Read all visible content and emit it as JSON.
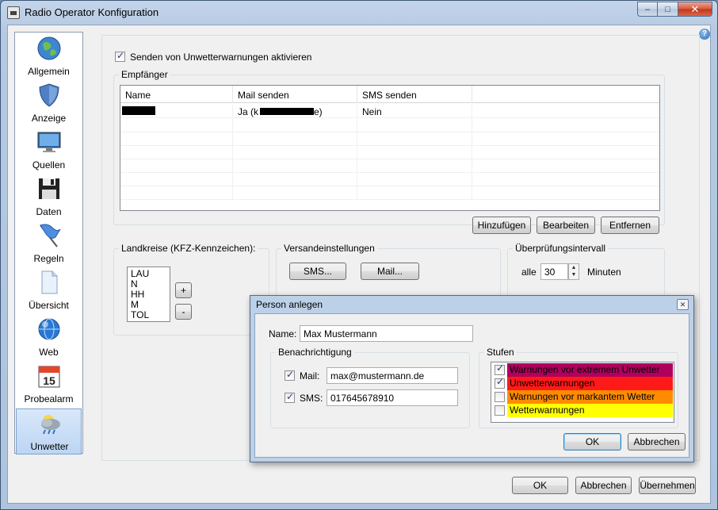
{
  "window": {
    "title": "Radio Operator Konfiguration",
    "controls": {
      "minimize": "–",
      "maximize": "□",
      "close": "✕"
    }
  },
  "sidebar": {
    "items": [
      {
        "label": "Allgemein",
        "icon": "globe-icon"
      },
      {
        "label": "Anzeige",
        "icon": "shield-icon"
      },
      {
        "label": "Quellen",
        "icon": "monitor-icon"
      },
      {
        "label": "Daten",
        "icon": "floppy-disk-icon"
      },
      {
        "label": "Regeln",
        "icon": "flag-icon"
      },
      {
        "label": "Übersicht",
        "icon": "document-icon"
      },
      {
        "label": "Web",
        "icon": "web-globe-icon"
      },
      {
        "label": "Probealarm",
        "icon": "calendar-icon",
        "icon_text": "15"
      },
      {
        "label": "Unwetter",
        "icon": "weather-icon",
        "selected": true
      }
    ]
  },
  "main": {
    "enable_label": "Senden von Unwetterwarnungen aktivieren",
    "enable_checked": true,
    "recipients": {
      "title": "Empfänger",
      "columns": [
        "Name",
        "Mail senden",
        "SMS senden",
        ""
      ],
      "rows": [
        {
          "name": "",
          "mail": "Ja (k",
          "mail_end": "e)",
          "sms": "Nein"
        }
      ],
      "buttons": {
        "add": "Hinzufügen",
        "edit": "Bearbeiten",
        "remove": "Entfernen"
      }
    },
    "districts": {
      "title": "Landkreise (KFZ-Kennzeichen):",
      "items": [
        "LAU",
        "N",
        "HH",
        "M",
        "TOL"
      ],
      "add": "+",
      "remove": "-"
    },
    "sending": {
      "title": "Versandeinstellungen",
      "sms_button": "SMS...",
      "mail_button": "Mail..."
    },
    "interval": {
      "title": "Überprüfungsintervall",
      "prefix": "alle",
      "value": "30",
      "unit": "Minuten"
    }
  },
  "footer": {
    "ok": "OK",
    "cancel": "Abbrechen",
    "apply": "Übernehmen"
  },
  "dialog": {
    "title": "Person anlegen",
    "close": "✕",
    "name_label": "Name:",
    "name_value": "Max Mustermann",
    "notification": {
      "title": "Benachrichtigung",
      "mail_label": "Mail:",
      "mail_checked": true,
      "mail_value": "max@mustermann.de",
      "sms_label": "SMS:",
      "sms_checked": true,
      "sms_value": "017645678910"
    },
    "levels": {
      "title": "Stufen",
      "items": [
        {
          "label": "Warnungen vor extremem Unwetter",
          "checked": true,
          "color": "#b0005e"
        },
        {
          "label": "Unwetterwarnungen",
          "checked": true,
          "color": "#ff1a1a"
        },
        {
          "label": "Warnungen vor markantem Wetter",
          "checked": false,
          "color": "#ff8c00"
        },
        {
          "label": "Wetterwarnungen",
          "checked": false,
          "color": "#ffff00"
        }
      ]
    },
    "ok": "OK",
    "cancel": "Abbrechen"
  }
}
